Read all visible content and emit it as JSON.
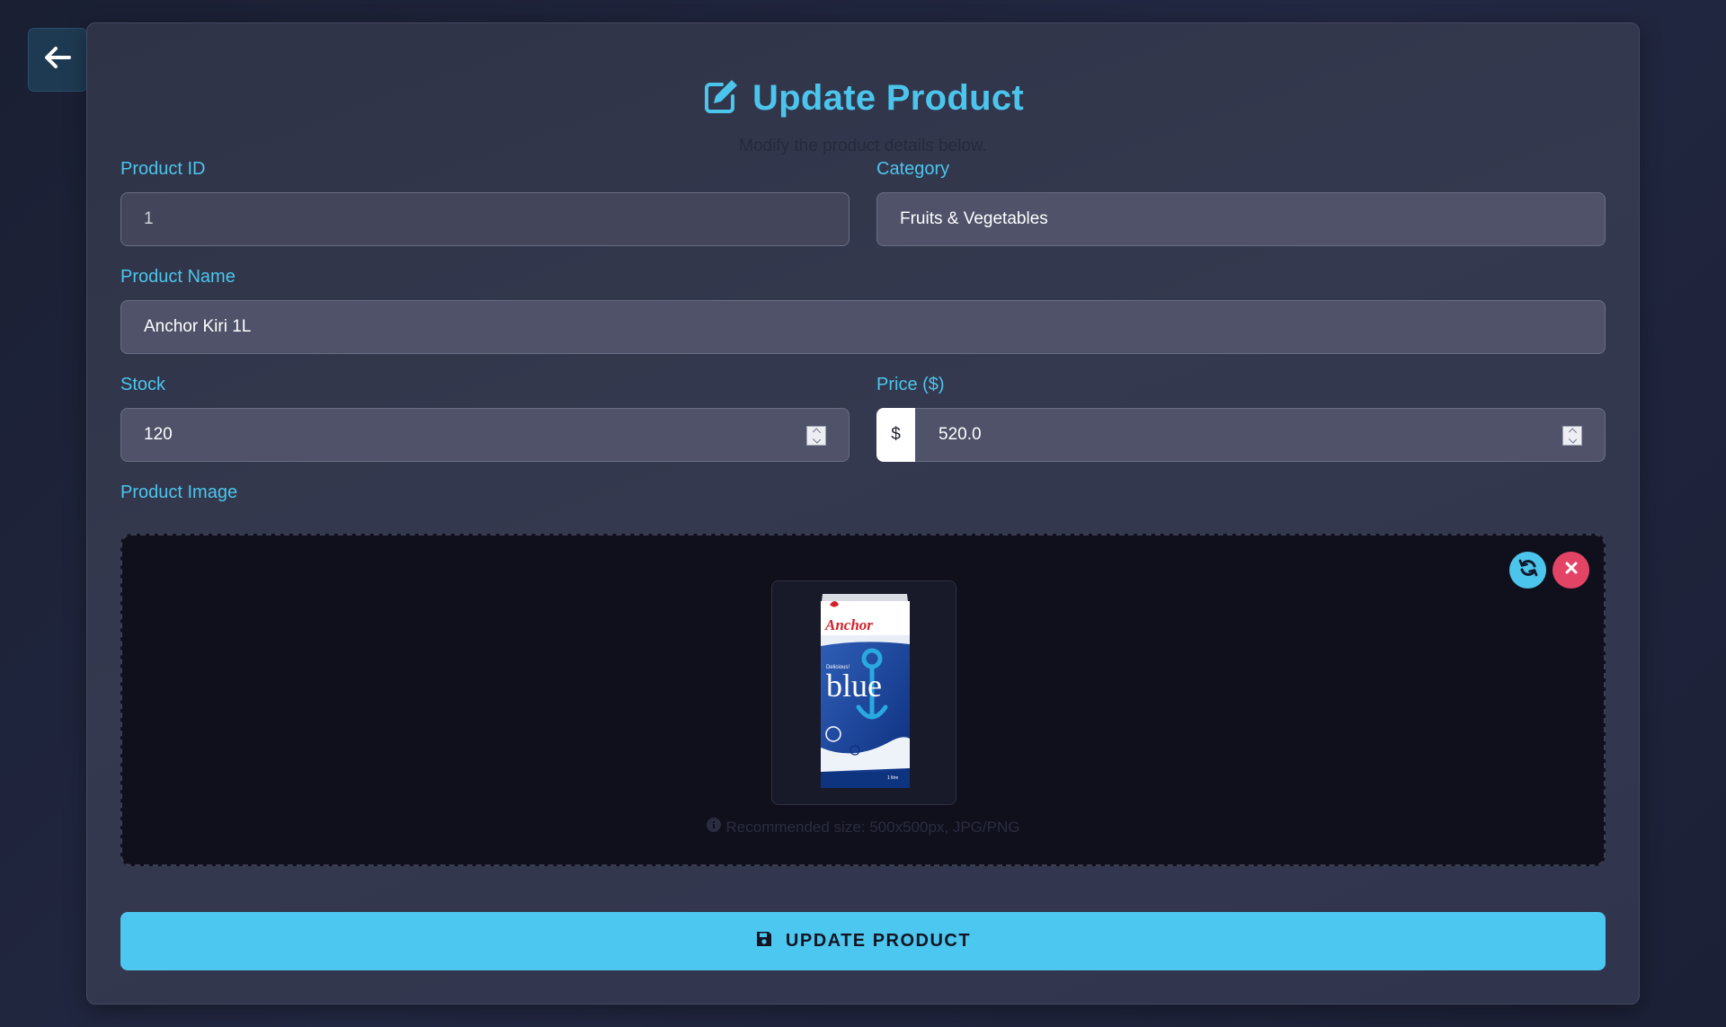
{
  "header": {
    "title": "Update Product",
    "subtitle": "Modify the product details below."
  },
  "form": {
    "product_id": {
      "label": "Product ID",
      "value": "1"
    },
    "category": {
      "label": "Category",
      "value": "Fruits & Vegetables"
    },
    "product_name": {
      "label": "Product Name",
      "value": "Anchor Kiri 1L"
    },
    "stock": {
      "label": "Stock",
      "value": "120"
    },
    "price": {
      "label": "Price ($)",
      "currency_symbol": "$",
      "value": "520.0"
    },
    "image": {
      "label": "Product Image",
      "hint": "Recommended size: 500x500px, JPG/PNG",
      "preview": {
        "brand_text": "Anchor",
        "product_text": "blue",
        "tagline_text": "Delicious!",
        "volume_text": "1 litre"
      }
    }
  },
  "actions": {
    "submit_label": "UPDATE PRODUCT"
  },
  "colors": {
    "accent": "#4cc5ec",
    "danger": "#e34466",
    "button": "#4cc8f0"
  },
  "icons": {
    "back": "arrow-left-icon",
    "title": "edit-icon",
    "replace": "refresh-icon",
    "remove": "close-icon",
    "hint": "info-icon",
    "submit": "save-icon"
  }
}
